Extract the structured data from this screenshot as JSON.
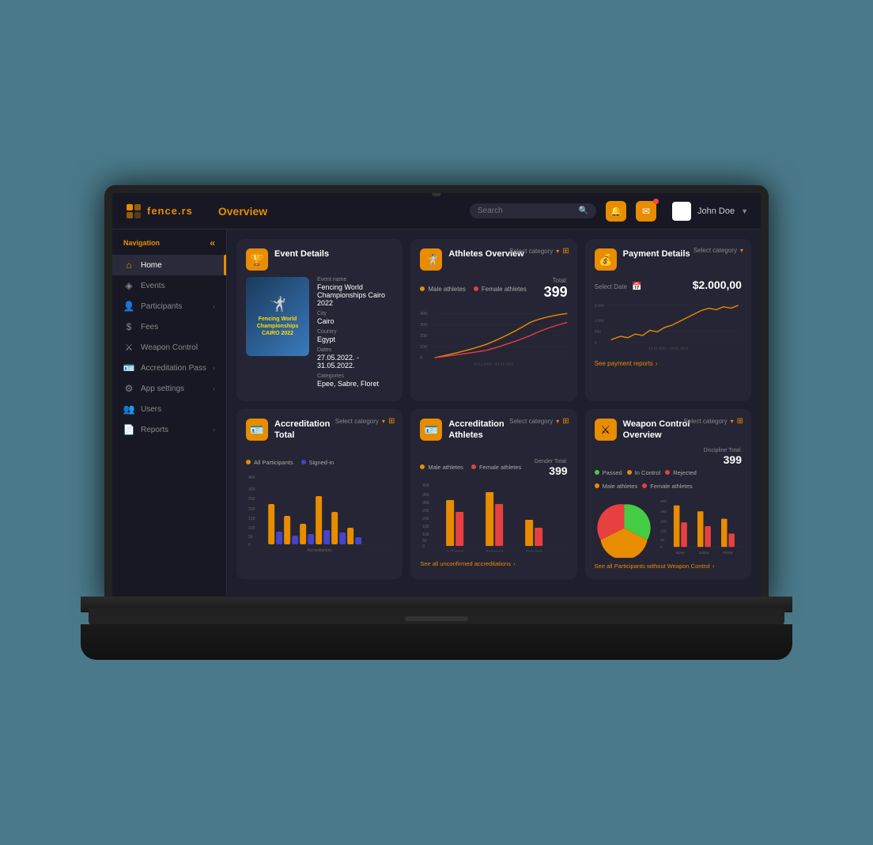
{
  "app": {
    "logo_text": "fence.rs",
    "page_title": "Overview",
    "search_placeholder": "Search"
  },
  "topbar": {
    "username": "John Doe"
  },
  "nav": {
    "label": "Navigation",
    "items": [
      {
        "id": "home",
        "label": "Home",
        "active": true
      },
      {
        "id": "events",
        "label": "Events",
        "active": false
      },
      {
        "id": "participants",
        "label": "Participants",
        "active": false
      },
      {
        "id": "fees",
        "label": "Fees",
        "active": false
      },
      {
        "id": "weapon-control",
        "label": "Weapon Control",
        "active": false
      },
      {
        "id": "accreditation-pass",
        "label": "Accreditation Pass",
        "active": false
      },
      {
        "id": "app-settings",
        "label": "App settings",
        "active": false
      },
      {
        "id": "users",
        "label": "Users",
        "active": false
      },
      {
        "id": "reports",
        "label": "Reports",
        "active": false
      }
    ]
  },
  "event_details": {
    "card_title": "Event Details",
    "event_name_label": "Event name",
    "event_name": "Fencing World Championships Cairo 2022",
    "city_label": "City",
    "city": "Cairo",
    "country_label": "Country",
    "country": "Egypt",
    "dates_label": "Dates",
    "dates": "27.05.2022. - 31.05.2022.",
    "categories_label": "Categories",
    "categories": "Epee, Sabre, Floret",
    "image_text1": "Fencing World",
    "image_text2": "Championships",
    "image_text3": "CAIRO 2022"
  },
  "athletes_overview": {
    "card_title": "Athletes Overview",
    "select_category": "Select category",
    "legend_male": "Male athletes",
    "legend_female": "Female athletes",
    "total_label": "Total:",
    "total": "399",
    "date_range": "14.12.2021 - 14.01.2022"
  },
  "payment_details": {
    "card_title": "Payment Details",
    "select_category": "Select category",
    "select_date": "Select Date",
    "amount": "$2.000,00",
    "see_reports": "See payment reports",
    "date_range": "14.12.2021 - 14.01.2022",
    "y_labels": [
      "3.000",
      "1.000",
      "500",
      "0"
    ]
  },
  "accreditation_total": {
    "card_title_line1": "Accreditation",
    "card_title_line2": "Total",
    "select_category": "Select category",
    "legend_all": "All Participants",
    "legend_signed": "Signed-in",
    "y_labels": [
      "400",
      "300",
      "250",
      "200",
      "150",
      "100",
      "50",
      "0"
    ],
    "x_label": "Accreditations"
  },
  "accreditation_athletes": {
    "card_title_line1": "Accreditation",
    "card_title_line2": "Athletes",
    "select_category": "Select category",
    "legend_male": "Male athletes",
    "legend_female": "Female athletes",
    "gender_total_label": "Gender Total:",
    "gender_total": "399",
    "x_labels": [
      "In Control",
      "Approved",
      "Rejected"
    ],
    "y_labels": [
      "400",
      "350",
      "300",
      "250",
      "200",
      "150",
      "100",
      "50",
      "0"
    ],
    "see_link": "See all unconfirmed accreditations"
  },
  "weapon_control": {
    "card_title_line1": "Weapon Control",
    "card_title_line2": "Overview",
    "select_category": "Select category",
    "discipline_total_label": "Discipline Total:",
    "discipline_total": "399",
    "legend_passed": "Passed",
    "legend_in_control": "In Control",
    "legend_rejected": "Rejected",
    "legend_male": "Male athletes",
    "legend_female": "Female athletes",
    "x_labels": [
      "Epee",
      "Sabre",
      "Floret"
    ],
    "y_labels": [
      "400",
      "260",
      "200",
      "130",
      "50",
      "0"
    ],
    "see_link": "See all Participants without Weapon Control",
    "pie": {
      "passed_pct": 35,
      "in_control_pct": 40,
      "rejected_pct": 25
    }
  },
  "colors": {
    "accent": "#e88c00",
    "bg_dark": "#1e1e2e",
    "card_bg": "#252535",
    "sidebar_bg": "#181824",
    "text_primary": "#ffffff",
    "text_secondary": "#888888",
    "male_color": "#e88c00",
    "female_color": "#e84040",
    "all_participants": "#e88c00",
    "signed_in": "#4444cc",
    "passed_color": "#44cc44",
    "in_control_color": "#e88c00",
    "rejected_color": "#e84040"
  }
}
